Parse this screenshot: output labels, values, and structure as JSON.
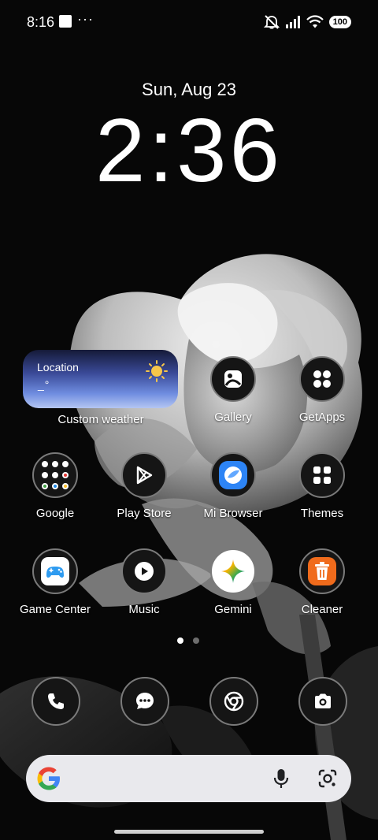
{
  "status_bar": {
    "time": "8:16",
    "battery": "100",
    "icons": [
      "notification-square-icon",
      "more-dots-icon",
      "mute-icon",
      "signal-icon",
      "wifi-icon",
      "battery-icon"
    ]
  },
  "lockscreen": {
    "date": "Sun, Aug 23",
    "time": "2:36"
  },
  "weather_widget": {
    "location": "Location",
    "temperature": "_°",
    "label": "Custom weather",
    "icon": "sun-icon"
  },
  "apps": [
    {
      "label": "Gallery",
      "icon": "gallery-icon"
    },
    {
      "label": "GetApps",
      "icon": "getapps-icon"
    },
    {
      "label": "Google",
      "icon": "google-folder-icon"
    },
    {
      "label": "Play Store",
      "icon": "play-store-icon"
    },
    {
      "label": "Mi Browser",
      "icon": "mi-browser-icon"
    },
    {
      "label": "Themes",
      "icon": "themes-icon"
    },
    {
      "label": "Game Center",
      "icon": "game-center-icon"
    },
    {
      "label": "Music",
      "icon": "music-icon"
    },
    {
      "label": "Gemini",
      "icon": "gemini-icon"
    },
    {
      "label": "Cleaner",
      "icon": "cleaner-icon"
    }
  ],
  "page_indicator": {
    "pages": 2,
    "current": 1
  },
  "dock": [
    {
      "icon": "phone-icon"
    },
    {
      "icon": "messages-icon"
    },
    {
      "icon": "chrome-icon"
    },
    {
      "icon": "camera-icon"
    }
  ],
  "search_bar": {
    "icons": [
      "google-logo-icon",
      "microphone-icon",
      "lens-icon"
    ]
  },
  "colors": {
    "cleaner_orange": "#f06b1c",
    "weather_gradient_top": "#151a38",
    "weather_gradient_bottom": "#b4c6f2",
    "mi_browser_blue": "#2d84f5"
  }
}
